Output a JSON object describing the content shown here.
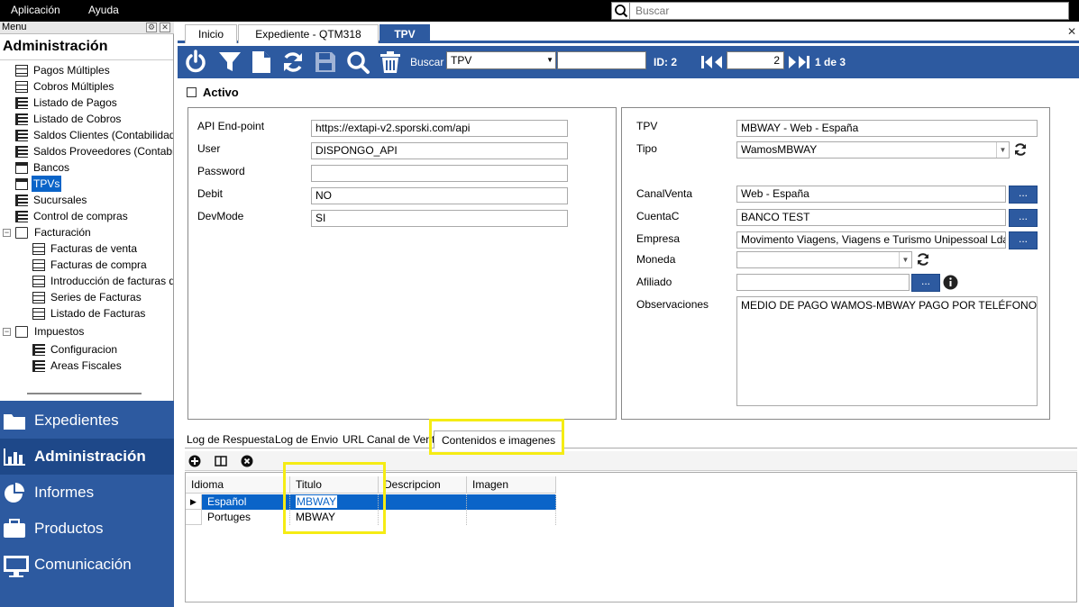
{
  "menubar": {
    "aplicacion": "Aplicación",
    "ayuda": "Ayuda",
    "search_placeholder": "Buscar"
  },
  "sidebar": {
    "header_label": "Menu",
    "title": "Administración",
    "items": [
      {
        "label": "Pagos Múltiples",
        "icon": "doc-icon"
      },
      {
        "label": "Cobros Múltiples",
        "icon": "doc-icon"
      },
      {
        "label": "Listado de Pagos",
        "icon": "list-icon"
      },
      {
        "label": "Listado de Cobros",
        "icon": "list-icon"
      },
      {
        "label": "Saldos Clientes (Contabilidad",
        "icon": "list-icon"
      },
      {
        "label": "Saldos Proveedores (Contabil",
        "icon": "list-icon"
      },
      {
        "label": "Bancos",
        "icon": "card-icon"
      },
      {
        "label": "TPVs",
        "icon": "card-icon"
      },
      {
        "label": "Sucursales",
        "icon": "list-icon"
      },
      {
        "label": "Control de compras",
        "icon": "list-icon"
      },
      {
        "label": "Facturación",
        "icon": "folder-icon"
      },
      {
        "label": "Facturas de venta",
        "icon": "doc-icon"
      },
      {
        "label": "Facturas de compra",
        "icon": "doc-icon"
      },
      {
        "label": "Introducción de facturas d",
        "icon": "doc-icon"
      },
      {
        "label": "Series de Facturas",
        "icon": "doc-icon"
      },
      {
        "label": "Listado de Facturas",
        "icon": "doc-icon"
      },
      {
        "label": "Impuestos",
        "icon": "folder-icon"
      },
      {
        "label": "Configuracion",
        "icon": "list-icon"
      },
      {
        "label": "Areas Fiscales",
        "icon": "list-icon"
      }
    ],
    "selected": "TPVs",
    "nav": [
      {
        "label": "Expedientes",
        "icon": "folder-icon"
      },
      {
        "label": "Administración",
        "icon": "bar-chart-icon"
      },
      {
        "label": "Informes",
        "icon": "pie-chart-icon"
      },
      {
        "label": "Productos",
        "icon": "briefcase-icon"
      },
      {
        "label": "Comunicación",
        "icon": "monitor-icon"
      }
    ]
  },
  "tabs": [
    {
      "label": "Inicio"
    },
    {
      "label": "Expediente  - QTM318"
    },
    {
      "label": "TPV"
    }
  ],
  "toolbar": {
    "buscar_label": "Buscar",
    "buscar_value": "TPV",
    "id_label": "ID: 2",
    "page_value": "2",
    "page_of": "1 de 3"
  },
  "activo": {
    "label": "Activo",
    "checked": false
  },
  "left_form": {
    "fields": [
      {
        "label": "API End-point",
        "value": "https://extapi-v2.sporski.com/api"
      },
      {
        "label": "User",
        "value": "DISPONGO_API"
      },
      {
        "label": "Password",
        "value": ""
      },
      {
        "label": "Debit",
        "value": "NO"
      },
      {
        "label": "DevMode",
        "value": "SI"
      }
    ]
  },
  "right_form": {
    "tpv": {
      "label": "TPV",
      "value": "MBWAY - Web - España"
    },
    "tipo": {
      "label": "Tipo",
      "value": "WamosMBWAY"
    },
    "canal_venta": {
      "label": "CanalVenta",
      "value": "Web - España"
    },
    "cuenta_c": {
      "label": "CuentaC",
      "value": "BANCO TEST"
    },
    "empresa": {
      "label": "Empresa",
      "value": "Movimento Viagens, Viagens e Turismo Unipessoal Lda."
    },
    "moneda": {
      "label": "Moneda",
      "value": ""
    },
    "afiliado": {
      "label": "Afiliado",
      "value": ""
    },
    "observaciones": {
      "label": "Observaciones",
      "value": "MEDIO DE PAGO WAMOS-MBWAY PAGO POR TELÉFONO"
    },
    "ellipsis": "..."
  },
  "subtabs": [
    {
      "label": "Log de Respuesta"
    },
    {
      "label": "Log de Envio"
    },
    {
      "label": "URL Canal de Venta"
    },
    {
      "label": "Contenidos e imagenes"
    }
  ],
  "grid": {
    "columns": [
      "Idioma",
      "Titulo",
      "Descripcion",
      "Imagen"
    ],
    "rows": [
      {
        "idioma": "Español",
        "titulo": "MBWAY",
        "descripcion": "",
        "imagen": ""
      },
      {
        "idioma": "Portuges",
        "titulo": "MBWAY",
        "descripcion": "",
        "imagen": ""
      }
    ]
  },
  "colors": {
    "accent": "#2d5aa0",
    "selection": "#0a64c8",
    "highlight": "#f5ec14"
  }
}
